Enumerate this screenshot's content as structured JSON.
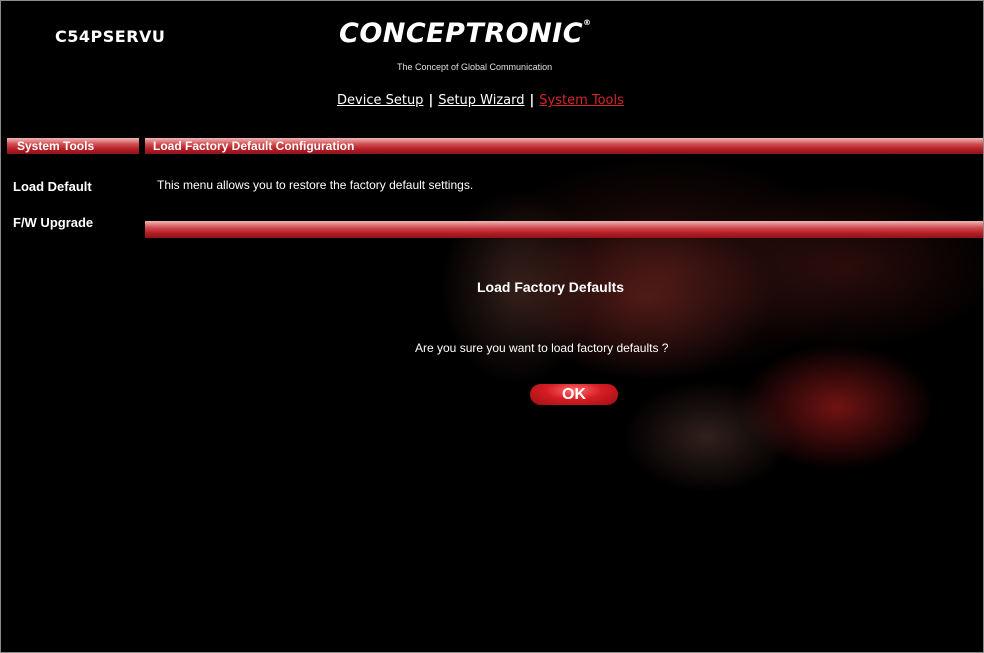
{
  "header": {
    "device_name": "C54PSERVU",
    "logo_text": "CONCEPTRONIC",
    "logo_reg": "®",
    "tagline": "The Concept of Global Communication"
  },
  "nav": {
    "items": [
      {
        "label": "Device Setup",
        "active": false
      },
      {
        "label": "Setup Wizard",
        "active": false
      },
      {
        "label": "System Tools",
        "active": true
      }
    ],
    "separator": "|"
  },
  "sidebar": {
    "title": "System Tools",
    "items": [
      {
        "label": "Load Default"
      },
      {
        "label": "F/W Upgrade"
      }
    ]
  },
  "main": {
    "section_title": "Load Factory Default Configuration",
    "description": "This menu allows you to restore the factory default settings.",
    "dialog": {
      "title": "Load Factory Defaults",
      "message": "Are you sure you want to load factory defaults ?",
      "ok_label": "OK"
    }
  },
  "colors": {
    "background": "#000000",
    "accent_red": "#b51f26",
    "active_nav": "#d4262a"
  }
}
